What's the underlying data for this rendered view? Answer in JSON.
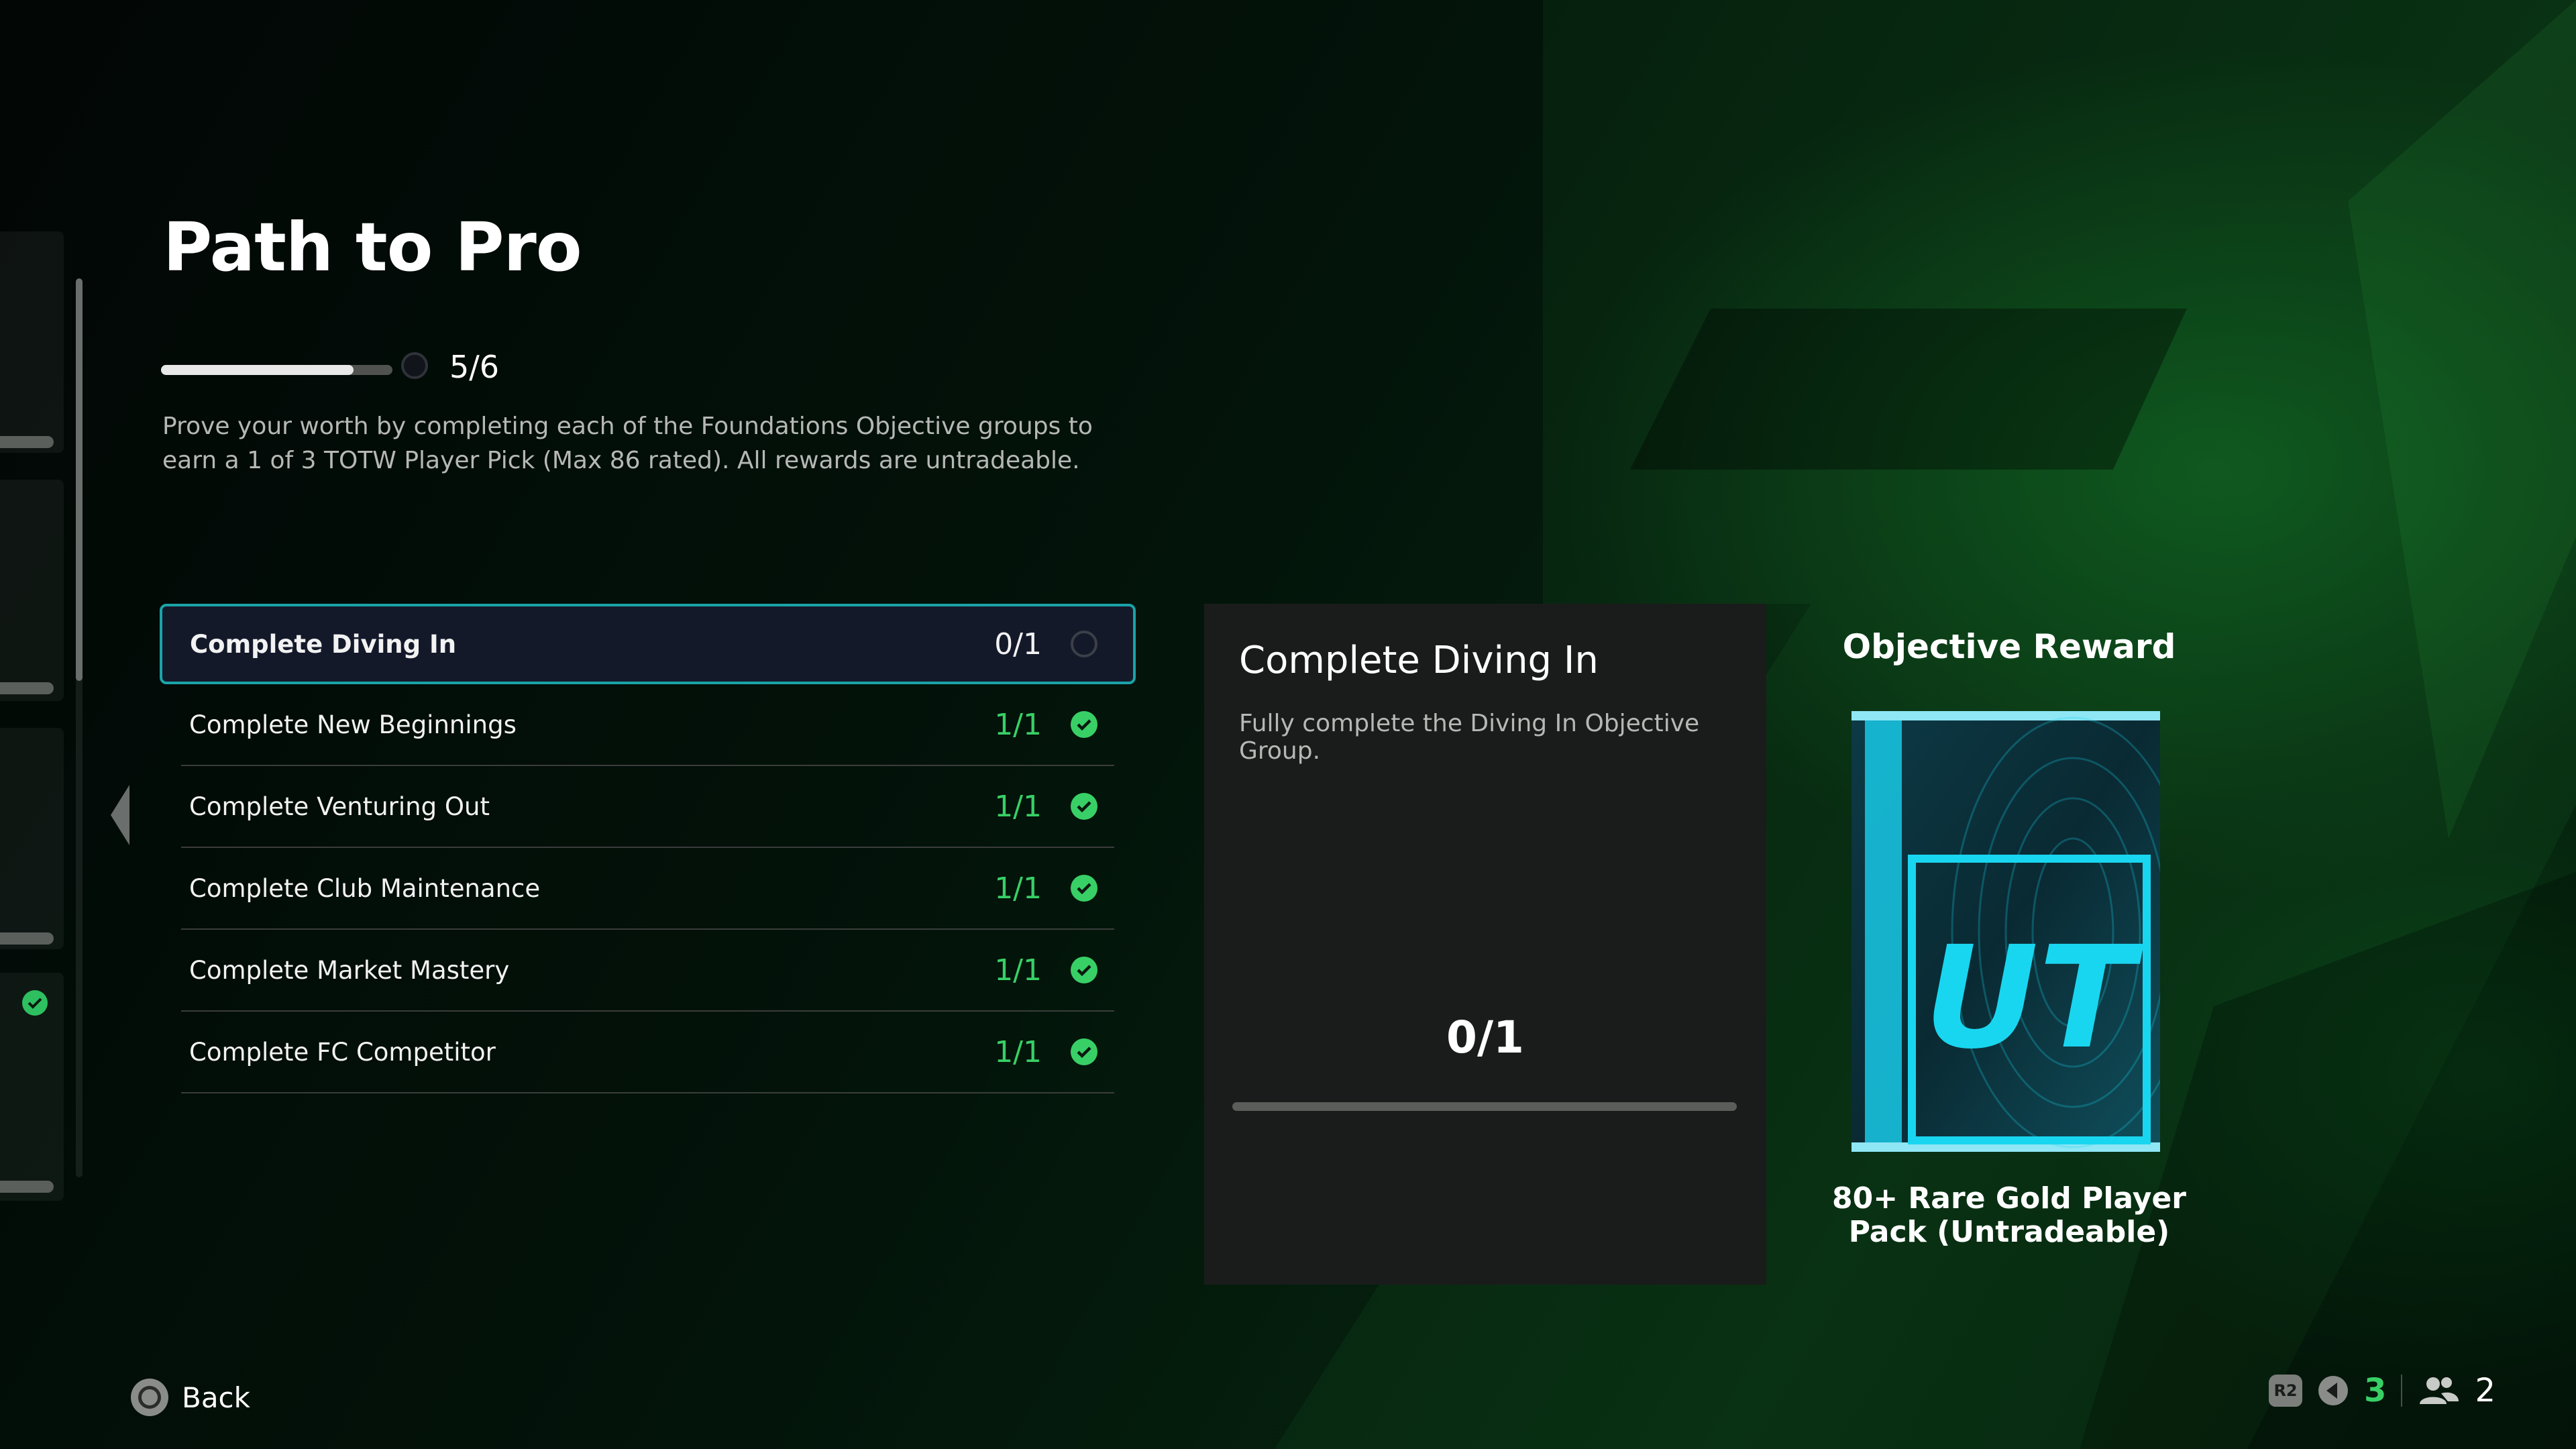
{
  "page": {
    "title": "Path to Pro"
  },
  "progress": {
    "label": "5/6",
    "fraction": 0.833
  },
  "description": "Prove your worth by completing each of the Foundations Objective groups to earn a 1 of 3 TOTW Player Pick (Max 86 rated). All rewards are untradeable.",
  "objectives": [
    {
      "label": "Complete Diving In",
      "count": "0/1",
      "status": "incomplete",
      "selected": true
    },
    {
      "label": "Complete New Beginnings",
      "count": "1/1",
      "status": "complete"
    },
    {
      "label": "Complete Venturing Out",
      "count": "1/1",
      "status": "complete"
    },
    {
      "label": "Complete Club Maintenance",
      "count": "1/1",
      "status": "complete"
    },
    {
      "label": "Complete Market Mastery",
      "count": "1/1",
      "status": "complete"
    },
    {
      "label": "Complete FC Competitor",
      "count": "1/1",
      "status": "complete"
    }
  ],
  "detail": {
    "title": "Complete Diving In",
    "description": "Fully complete the Diving In Objective Group.",
    "count": "0/1",
    "progress": 0
  },
  "reward": {
    "heading": "Objective Reward",
    "name_line1": "80+ Rare Gold Player",
    "name_line2": "Pack (Untradeable)",
    "pack_logo": "UT"
  },
  "footer": {
    "back_label": "Back",
    "r2_label": "R2",
    "hud_count_a": "3",
    "hud_count_b": "2"
  },
  "colors": {
    "accent_green": "#38d066",
    "selected_border": "#1aa3a8",
    "pack_cyan": "#19d6f0"
  }
}
